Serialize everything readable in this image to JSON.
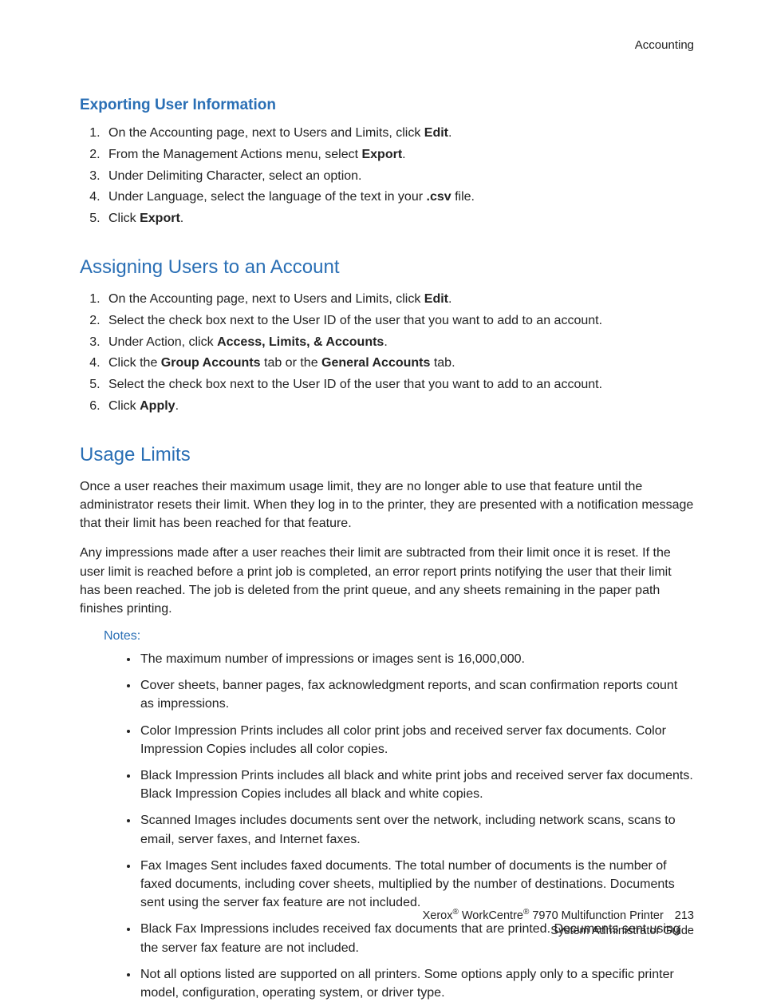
{
  "header": {
    "section": "Accounting"
  },
  "section1": {
    "title": "Exporting User Information",
    "steps": [
      {
        "pre": "On the Accounting page, next to Users and Limits, click ",
        "b": "Edit",
        "post": "."
      },
      {
        "pre": "From the Management Actions menu, select ",
        "b": "Export",
        "post": "."
      },
      {
        "pre": "Under Delimiting Character, select an option.",
        "b": "",
        "post": ""
      },
      {
        "pre": "Under Language, select the language of the text in your ",
        "b": ".csv",
        "post": " file."
      },
      {
        "pre": "Click ",
        "b": "Export",
        "post": "."
      }
    ]
  },
  "section2": {
    "title": "Assigning Users to an Account",
    "steps": [
      {
        "pre": "On the Accounting page, next to Users and Limits, click ",
        "b": "Edit",
        "post": "."
      },
      {
        "pre": "Select the check box next to the User ID of the user that you want to add to an account.",
        "b": "",
        "post": ""
      },
      {
        "pre": "Under Action, click ",
        "b": "Access, Limits, & Accounts",
        "post": "."
      },
      {
        "pre": "Click the ",
        "b": "Group Accounts",
        "mid": " tab or the ",
        "b2": "General Accounts",
        "post": " tab."
      },
      {
        "pre": "Select the check box next to the User ID of the user that you want to add to an account.",
        "b": "",
        "post": ""
      },
      {
        "pre": "Click ",
        "b": "Apply",
        "post": "."
      }
    ]
  },
  "section3": {
    "title": "Usage Limits",
    "para1": "Once a user reaches their maximum usage limit, they are no longer able to use that feature until the administrator resets their limit. When they log in to the printer, they are presented with a notification message that their limit has been reached for that feature.",
    "para2": "Any impressions made after a user reaches their limit are subtracted from their limit once it is reset. If the user limit is reached before a print job is completed, an error report prints notifying the user that their limit has been reached. The job is deleted from the print queue, and any sheets remaining in the paper path finishes printing.",
    "notes_label": "Notes:",
    "notes": [
      "The maximum number of impressions or images sent is 16,000,000.",
      "Cover sheets, banner pages, fax acknowledgment reports, and scan confirmation reports count as impressions.",
      "Color Impression Prints includes all color print jobs and received server fax documents. Color Impression Copies includes all color copies.",
      "Black Impression Prints includes all black and white print jobs and received server fax documents. Black Impression Copies includes all black and white copies.",
      "Scanned Images includes documents sent over the network, including network scans, scans to email, server faxes, and Internet faxes.",
      "Fax Images Sent includes faxed documents. The total number of documents is the number of faxed documents, including cover sheets, multiplied by the number of destinations. Documents sent using the server fax feature are not included.",
      "Black Fax Impressions includes received fax documents that are printed. Documents sent using the server fax feature are not included.",
      "Not all options listed are supported on all printers. Some options apply only to a specific printer model, configuration, operating system, or driver type."
    ]
  },
  "footer": {
    "brand1": "Xerox",
    "reg": "®",
    "brand2": " WorkCentre",
    "model": " 7970 Multifunction Printer",
    "page": "213",
    "line2": "System Administrator Guide"
  }
}
